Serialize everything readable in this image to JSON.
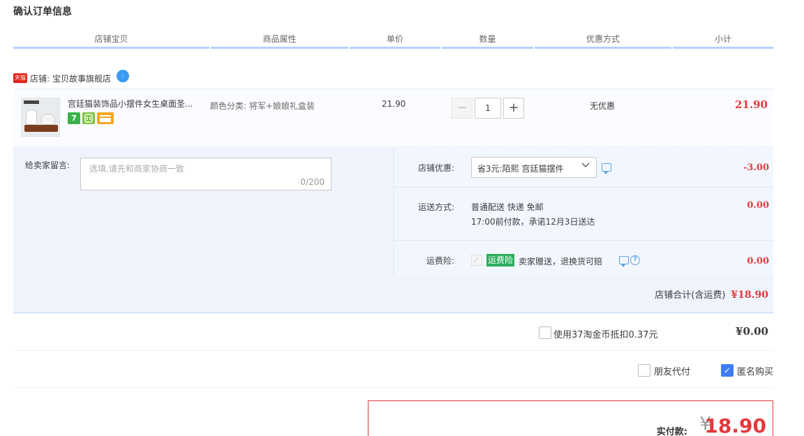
{
  "page": {
    "title": "确认订单信息"
  },
  "columns": [
    "店铺宝贝",
    "商品属性",
    "单价",
    "数量",
    "优惠方式",
    "小计"
  ],
  "shop": {
    "badge": "天猫",
    "label": "店铺:",
    "name": "宝贝故事旗舰店"
  },
  "item": {
    "title": "宫廷猫装饰品小摆件女生桌面圣...",
    "tags": [
      "7",
      "",
      ""
    ],
    "attribute": "颜色分类: 将军+娘娘礼盒装",
    "unit_price": "21.90",
    "qty_minus": "−",
    "quantity": "1",
    "qty_plus": "+",
    "discount": "无优惠",
    "subtotal": "21.90"
  },
  "note": {
    "label": "给卖家留言:",
    "placeholder": "选填,请先和商家协商一致",
    "count": "0/200"
  },
  "shop_discount": {
    "label": "店铺优惠:",
    "selected": "省3元:陌熙 宫廷猫摆件",
    "amount": "-3.00"
  },
  "shipping": {
    "label": "运送方式:",
    "line1": "普通配送 快递 免邮",
    "line2": "17:00前付款，承诺12月3日送达",
    "amount": "0.00"
  },
  "insurance": {
    "label": "运费险:",
    "check": "✓",
    "badge": "运费险",
    "text": "卖家赠送，退换货可赔",
    "help": "?",
    "amount": "0.00"
  },
  "shop_total": {
    "label": "店铺合计(含运费)",
    "amount": "¥18.90"
  },
  "coins": {
    "text": "使用37淘金币抵扣0.37元",
    "amount": "¥0.00"
  },
  "options": {
    "friend_pay": "朋友代付",
    "anonymous": "匿名购买",
    "anonymous_check": "✓"
  },
  "payment": {
    "label": "实付款:",
    "yen": "¥",
    "amount": "18.90"
  },
  "colors": {
    "accent": "#e4393c",
    "header_line": "#b2d1ff",
    "checkbox": "#3e7cf7",
    "insurance": "#2bae5c"
  }
}
